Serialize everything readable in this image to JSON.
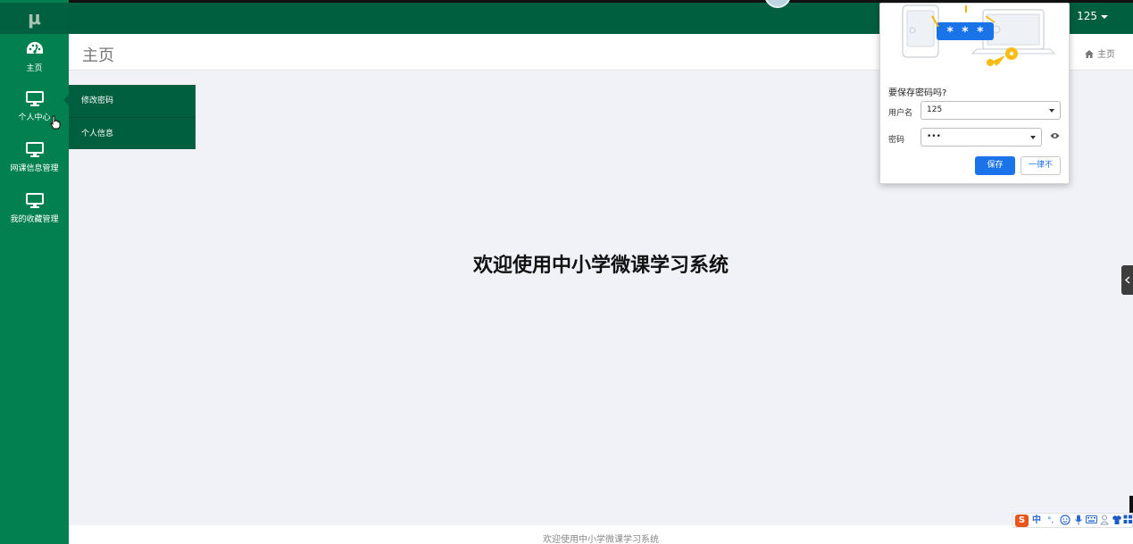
{
  "logo": "μ",
  "header": {
    "user": "125"
  },
  "sidebar": {
    "items": [
      {
        "label": "主页",
        "icon": "dashboard-icon"
      },
      {
        "label": "个人中心",
        "icon": "monitor-icon"
      },
      {
        "label": "网课信息管理",
        "icon": "monitor-icon"
      },
      {
        "label": "我的收藏管理",
        "icon": "monitor-icon"
      }
    ]
  },
  "submenu": {
    "items": [
      "修改密码",
      "个人信息"
    ]
  },
  "page": {
    "title": "主页",
    "breadcrumb": "主页"
  },
  "main": {
    "welcome": "欢迎使用中小学微课学习系统"
  },
  "footer": {
    "text": "欢迎使用中小学微课学习系统"
  },
  "password_dialog": {
    "question": "要保存密码吗?",
    "username_label": "用户名",
    "username_value": "125",
    "password_label": "密码",
    "password_value": "•••",
    "save_label": "保存",
    "never_label": "一律不",
    "illustration_stars": "* * *"
  },
  "ime": {
    "logo": "S",
    "mode": "中",
    "punct": "°,"
  },
  "colors": {
    "sidebar": "#028050",
    "topbar": "#005f3f",
    "submenu": "#005f3f",
    "primary_button": "#1a73e8"
  }
}
